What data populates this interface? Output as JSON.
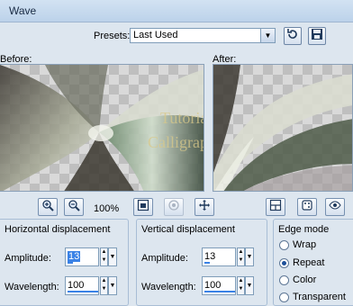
{
  "window": {
    "title": "Wave"
  },
  "presets": {
    "label": "Presets:",
    "value": "Last Used"
  },
  "preview": {
    "before_label": "Before:",
    "after_label": "After:",
    "watermark_line1": "Tutorial",
    "watermark_line2": "Calligraphy",
    "zoom": "100%"
  },
  "horizontal": {
    "title": "Horizontal displacement",
    "amplitude_label": "Amplitude:",
    "amplitude": "13",
    "wavelength_label": "Wavelength:",
    "wavelength": "100"
  },
  "vertical": {
    "title": "Vertical displacement",
    "amplitude_label": "Amplitude:",
    "amplitude": "13",
    "wavelength_label": "Wavelength:",
    "wavelength": "100"
  },
  "edge_mode": {
    "title": "Edge mode",
    "options": [
      "Wrap",
      "Repeat",
      "Color",
      "Transparent"
    ],
    "selected": "Repeat"
  },
  "colors": {
    "accent": "#3a82e6",
    "background": "#dde6ef"
  }
}
